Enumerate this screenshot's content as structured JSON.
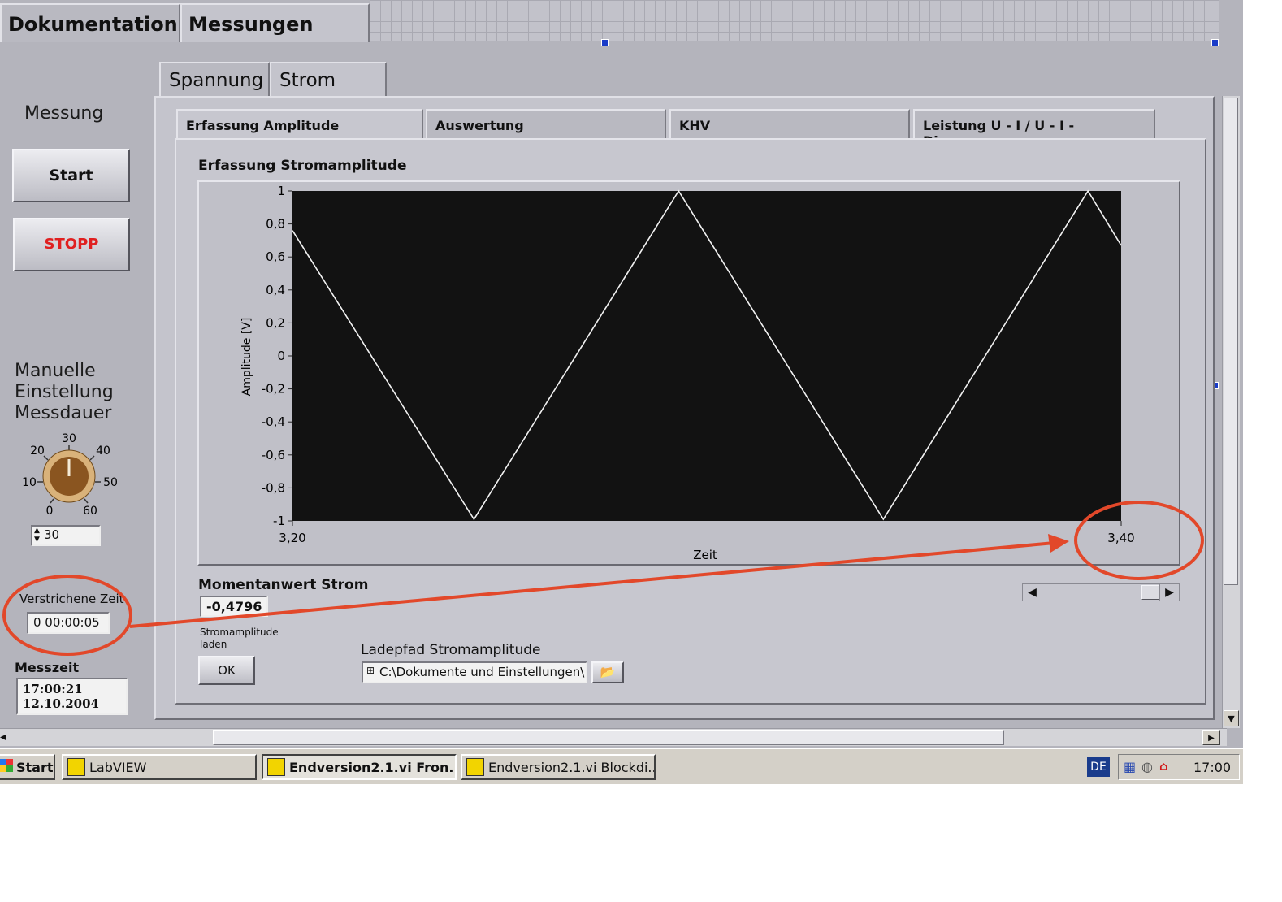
{
  "tabs_outer": [
    "Dokumentation",
    "Messungen"
  ],
  "tabs_mid": [
    "Spannung",
    "Strom"
  ],
  "tabs_inner": [
    "Erfassung Amplitude",
    "Auswertung",
    "KHV",
    "Leistung U - I / U - I - Diagramm"
  ],
  "left": {
    "messung_label": "Messung",
    "start_label": "Start",
    "stopp_label": "STOPP",
    "manual_line1": "Manuelle",
    "manual_line2": "Einstellung",
    "manual_line3": "Messdauer",
    "knob_scale": [
      "0",
      "10",
      "20",
      "30",
      "40",
      "50",
      "60"
    ],
    "knob_value": 30,
    "knob_display": "30",
    "elapsed_label": "Verstrichene Zeit",
    "elapsed_value": "0  00:00:05",
    "messzeit_label": "Messzeit",
    "messzeit_time": "17:00:21",
    "messzeit_date": "12.10.2004"
  },
  "main": {
    "chart_title": "Erfassung Stromamplitude",
    "momentan_label": "Momentanwert Strom",
    "momentan_value": "-0,4796",
    "load_label_line1": "Stromamplitude",
    "load_label_line2": "laden",
    "ok_label": "OK",
    "path_label": "Ladepfad Stromamplitude",
    "path_value": "C:\\Dokumente und Einstellungen\\"
  },
  "chart_data": {
    "type": "line",
    "title": "Erfassung Stromamplitude",
    "xlabel": "Zeit",
    "ylabel": "Amplitude [V]",
    "xlim": [
      3.2,
      3.4
    ],
    "ylim": [
      -1,
      1
    ],
    "x_ticks": [
      "3,20",
      "3,40"
    ],
    "y_ticks": [
      "1",
      "0,8",
      "0,6",
      "0,4",
      "0,2",
      "0",
      "-0,2",
      "-0,4",
      "-0,6",
      "-0,8",
      "-1"
    ],
    "series": [
      {
        "x": [
          3.2,
          3.2438,
          3.2932,
          3.3426,
          3.392,
          3.4
        ],
        "y": [
          0.76,
          -0.99,
          1.0,
          -0.99,
          1.0,
          0.67
        ]
      }
    ],
    "grid": false,
    "plot_background": "#121212",
    "line_color": "#f2f2f2"
  },
  "annotation_color": "#e2482a",
  "taskbar": {
    "start_label": "Start",
    "items": [
      "LabVIEW",
      "Endversion2.1.vi Fron...",
      "Endversion2.1.vi Blockdi..."
    ],
    "lang": "DE",
    "clock": "17:00"
  }
}
